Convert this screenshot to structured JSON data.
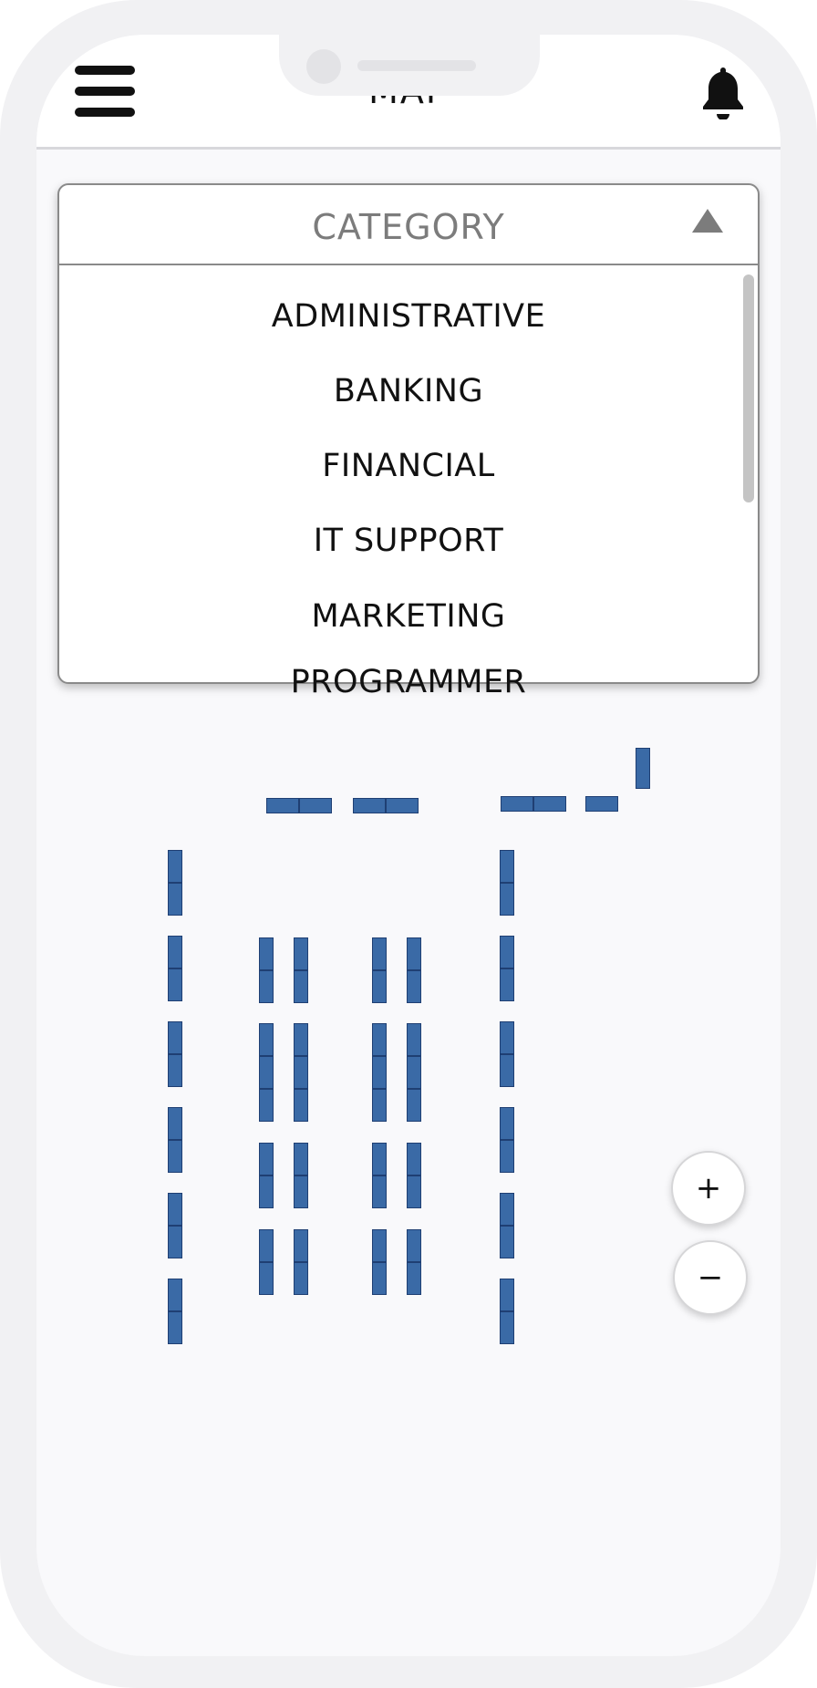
{
  "header": {
    "title": "MAP"
  },
  "icons": {
    "menu": "hamburger-menu-icon",
    "notifications": "bell-icon"
  },
  "category_dropdown": {
    "placeholder": "CATEGORY",
    "expanded": true,
    "options": [
      "ADMINISTRATIVE",
      "BANKING",
      "FINANCIAL",
      "IT  SUPPORT",
      "MARKETING",
      "PROGRAMMER"
    ]
  },
  "zoom": {
    "in_label": "+",
    "out_label": "−"
  },
  "colors": {
    "desk": "#3a6aa6",
    "desk_border": "#1f3f73",
    "frame": "#f1f1f3"
  }
}
